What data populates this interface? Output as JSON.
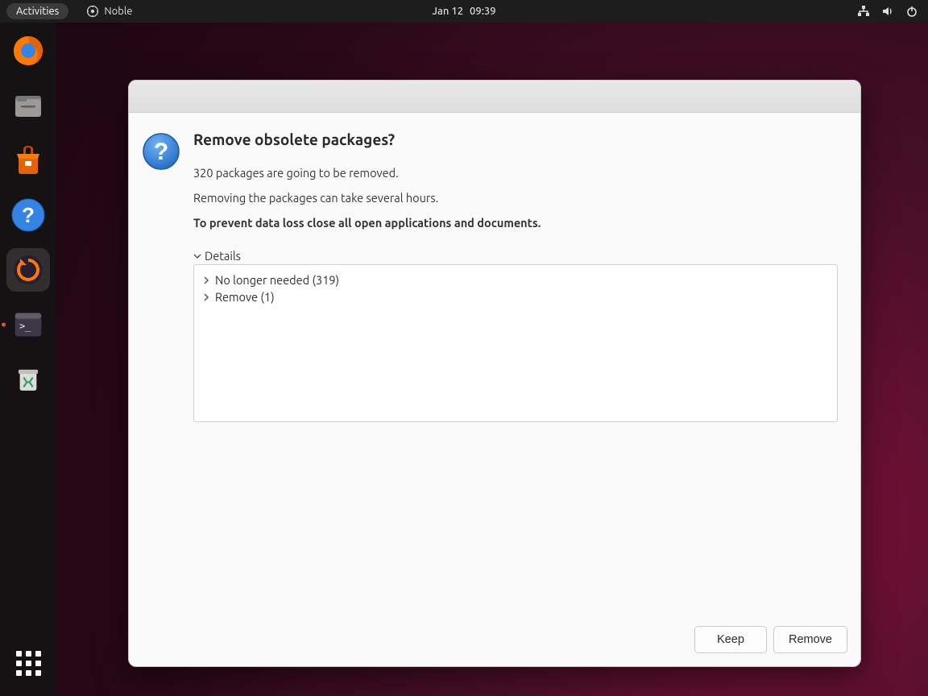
{
  "panel": {
    "activities": "Activities",
    "app_name": "Noble",
    "date": "Jan 12",
    "time": "09:39"
  },
  "dock": {
    "items": [
      {
        "name": "firefox"
      },
      {
        "name": "files"
      },
      {
        "name": "software"
      },
      {
        "name": "help"
      },
      {
        "name": "updater",
        "active": true
      },
      {
        "name": "terminal",
        "running": true
      },
      {
        "name": "trash"
      }
    ]
  },
  "dialog": {
    "title": "Remove obsolete packages?",
    "line1": "320 packages are going to be removed.",
    "line2": "Removing the packages can take several hours.",
    "warning": "To prevent data loss close all open applications and documents.",
    "details_label": "Details",
    "tree": [
      {
        "label": "No longer needed (319)"
      },
      {
        "label": "Remove (1)"
      }
    ],
    "keep_label": "Keep",
    "remove_label": "Remove"
  }
}
